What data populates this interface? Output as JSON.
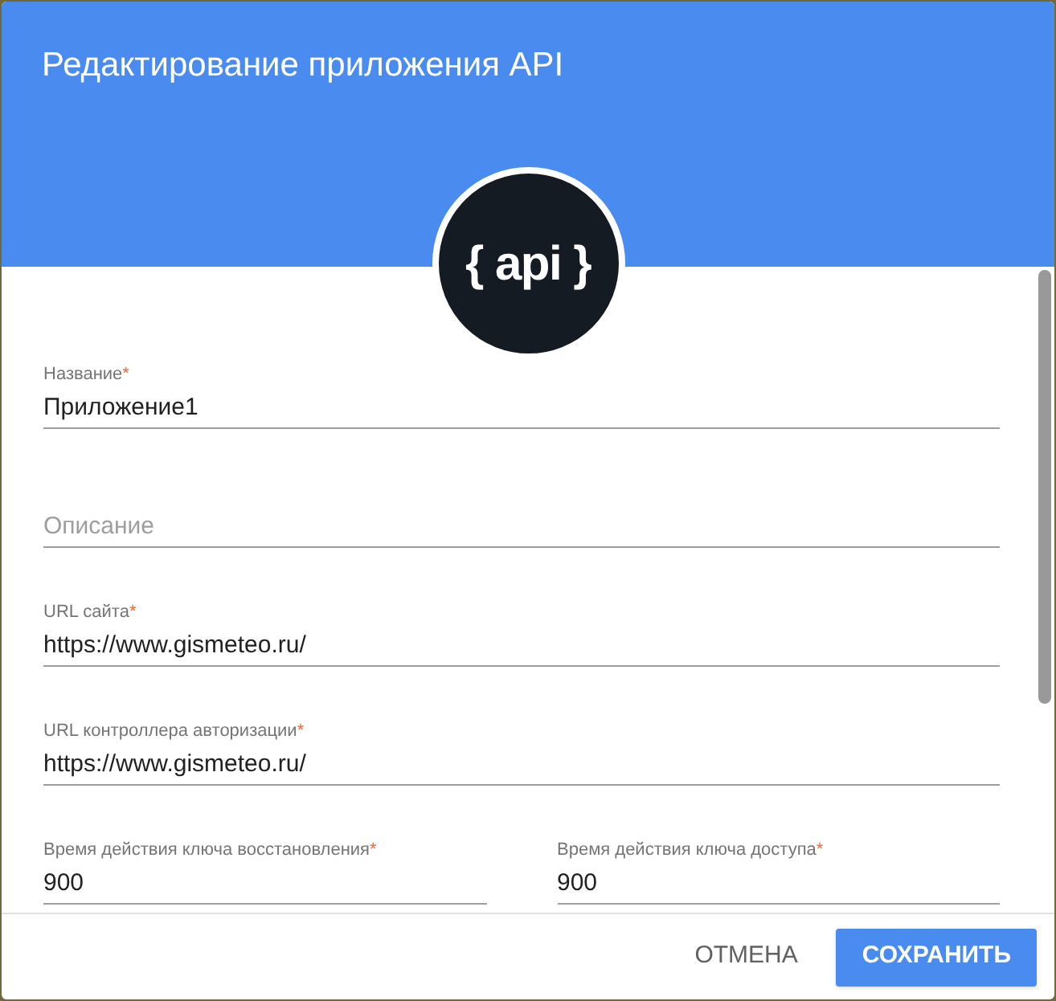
{
  "dialog": {
    "title": "Редактирование приложения API",
    "logo": "{ api }"
  },
  "fields": [
    {
      "label": "Название",
      "required_mark": "*",
      "value": "Приложение1"
    },
    {
      "placeholder": "Описание"
    },
    {
      "label": "URL сайта",
      "required_mark": "*",
      "value": "https://www.gismeteo.ru/"
    },
    {
      "label": "URL контроллера авторизации",
      "required_mark": "*",
      "value": "https://www.gismeteo.ru/"
    }
  ],
  "key_lifetimes": [
    {
      "label": "Время действия ключа восстановления",
      "required_mark": "*",
      "value": "900"
    },
    {
      "label": "Время действия ключа доступа",
      "required_mark": "*",
      "value": "900"
    }
  ],
  "buttons": [
    {
      "label": "ОТМЕНА",
      "kind": "flat"
    },
    {
      "label": "СОХРАНИТЬ",
      "kind": "primary"
    }
  ]
}
